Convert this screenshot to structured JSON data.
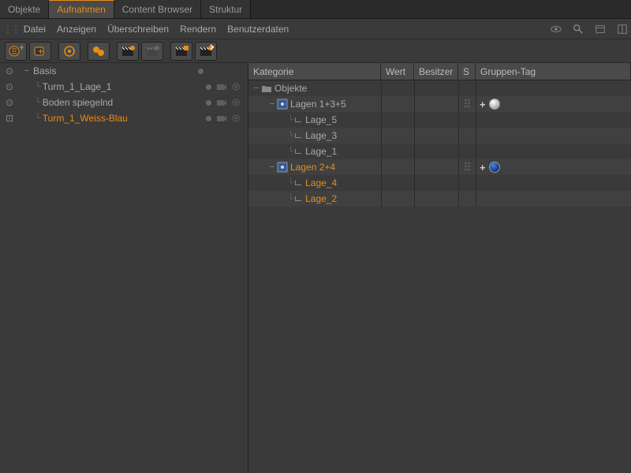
{
  "tabs": [
    {
      "label": "Objekte",
      "active": false
    },
    {
      "label": "Aufnahmen",
      "active": true
    },
    {
      "label": "Content Browser",
      "active": false
    },
    {
      "label": "Struktur",
      "active": false
    }
  ],
  "menu": {
    "items": [
      "Datei",
      "Anzeigen",
      "Überschreiben",
      "Rendern",
      "Benutzerdaten"
    ]
  },
  "left_tree": {
    "items": [
      {
        "name": "Basis",
        "selected": false,
        "indent": 0,
        "expanded": true,
        "showControls": false
      },
      {
        "name": "Turm_1_Lage_1",
        "selected": false,
        "indent": 1,
        "showControls": true
      },
      {
        "name": "Boden spiegelnd",
        "selected": false,
        "indent": 1,
        "showControls": true
      },
      {
        "name": "Turm_1_Weiss-Blau",
        "selected": true,
        "indent": 1,
        "showControls": true
      }
    ]
  },
  "table": {
    "headers": {
      "kategorie": "Kategorie",
      "wert": "Wert",
      "besitzer": "Besitzer",
      "s": "S",
      "gruppen": "Gruppen-Tag"
    },
    "rows": [
      {
        "type": "folder",
        "name": "Objekte",
        "indent": 0,
        "selected": false
      },
      {
        "type": "layergroup",
        "name": "Lagen 1+3+5",
        "indent": 1,
        "selected": false,
        "s": true,
        "tag": "white"
      },
      {
        "type": "layer",
        "name": "Lage_5",
        "indent": 2,
        "selected": false
      },
      {
        "type": "layer",
        "name": "Lage_3",
        "indent": 2,
        "selected": false
      },
      {
        "type": "layer",
        "name": "Lage_1",
        "indent": 2,
        "selected": false
      },
      {
        "type": "layergroup",
        "name": "Lagen 2+4",
        "indent": 1,
        "selected": true,
        "s": true,
        "tag": "blue"
      },
      {
        "type": "layer",
        "name": "Lage_4",
        "indent": 2,
        "selected": true
      },
      {
        "type": "layer",
        "name": "Lage_2",
        "indent": 2,
        "selected": true
      }
    ]
  }
}
